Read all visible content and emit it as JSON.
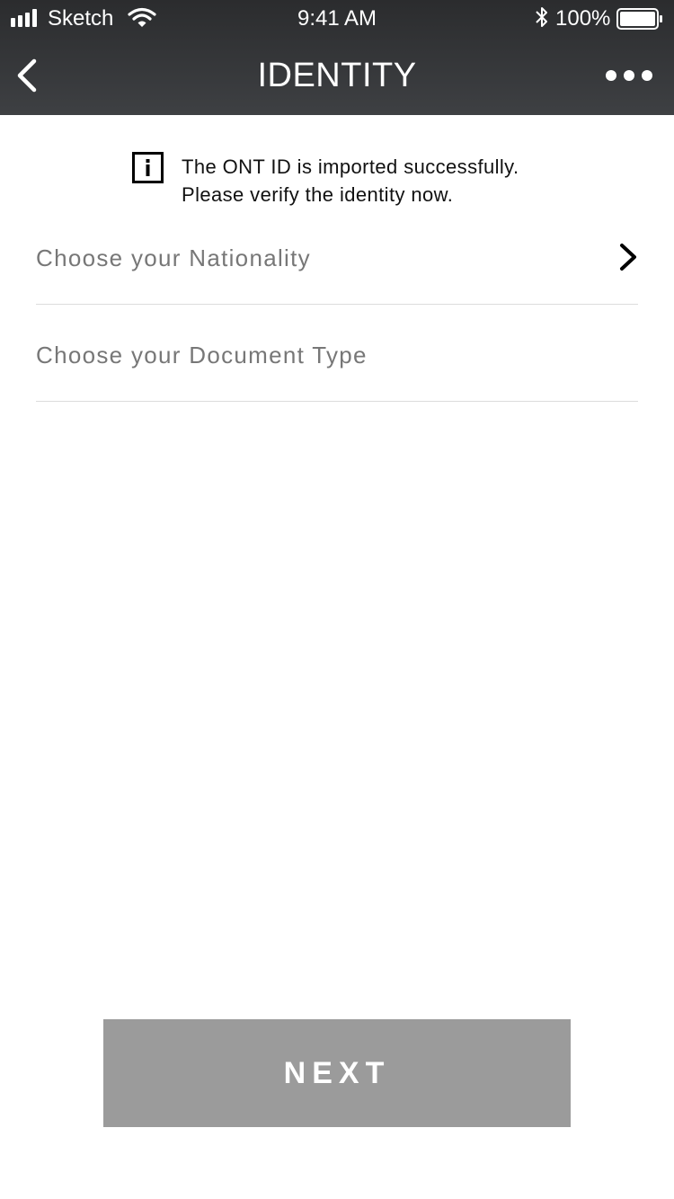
{
  "status_bar": {
    "carrier": "Sketch",
    "time": "9:41 AM",
    "battery_percent": "100%",
    "signal_icon": "signal-bars-icon",
    "wifi_icon": "wifi-icon",
    "bluetooth_icon": "bluetooth-icon",
    "battery_icon": "battery-icon",
    "battery_level": 1.0
  },
  "nav": {
    "title": "IDENTITY",
    "back_icon": "chevron-left-icon",
    "more_icon": "more-dots-icon",
    "background_color": "#313234"
  },
  "notice": {
    "icon": "info-icon",
    "line1": "The ONT ID is imported successfully.",
    "line2": "Please verify the identity now."
  },
  "form": {
    "nationality_label": "Choose your Nationality",
    "nationality_icon": "chevron-right-icon",
    "document_type_label": "Choose your Document Type"
  },
  "footer": {
    "next_label": "NEXT",
    "next_button_color": "#9b9b9b"
  }
}
